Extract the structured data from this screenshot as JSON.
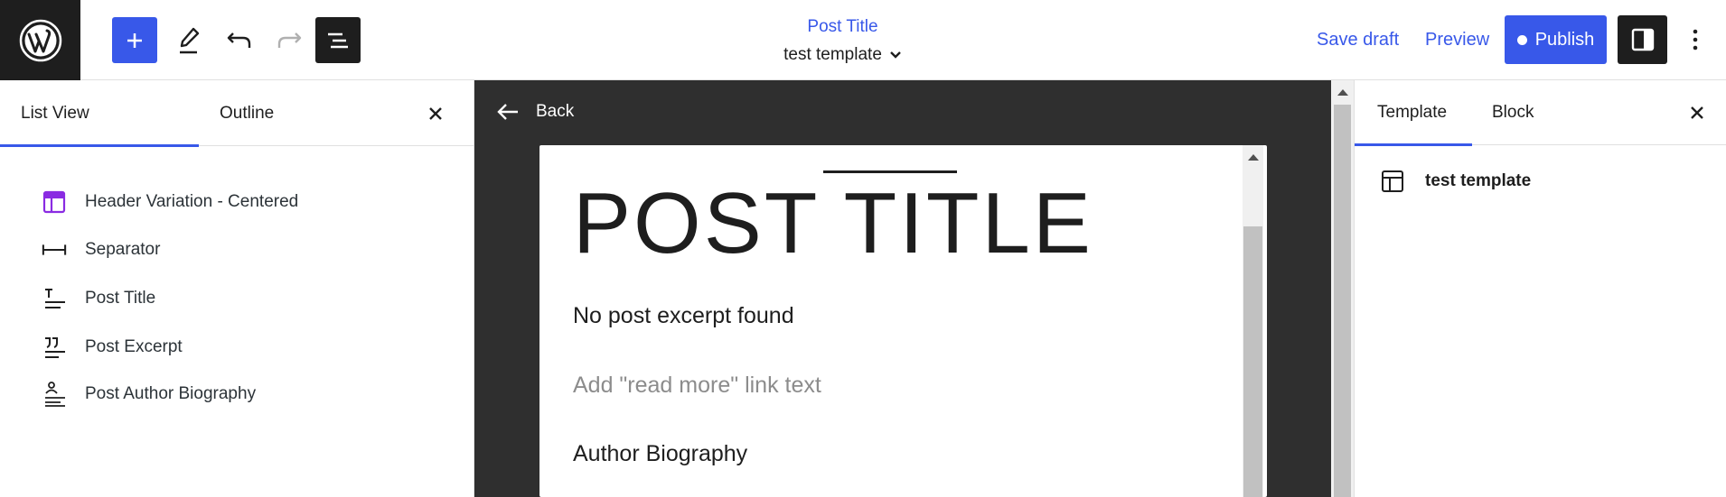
{
  "header": {
    "doc_title": "Post Title",
    "template_name": "test template",
    "save_draft": "Save draft",
    "preview": "Preview",
    "publish": "Publish"
  },
  "left_panel": {
    "tabs": [
      {
        "label": "List View",
        "active": true
      },
      {
        "label": "Outline",
        "active": false
      }
    ],
    "items": [
      {
        "label": "Header Variation - Centered",
        "icon": "template-part-icon"
      },
      {
        "label": "Separator",
        "icon": "separator-icon"
      },
      {
        "label": "Post Title",
        "icon": "post-title-icon"
      },
      {
        "label": "Post Excerpt",
        "icon": "post-excerpt-icon"
      },
      {
        "label": "Post Author Biography",
        "icon": "post-author-biography-icon"
      }
    ]
  },
  "canvas": {
    "back": "Back",
    "post_title": "POST TITLE",
    "excerpt": "No post excerpt found",
    "read_more": "Add \"read more\" link text",
    "author_bio": "Author Biography"
  },
  "right_panel": {
    "tabs": [
      {
        "label": "Template",
        "active": true
      },
      {
        "label": "Block",
        "active": false
      }
    ],
    "template_name": "test template"
  },
  "colors": {
    "accent": "#3858e9",
    "dark": "#1e1e1e",
    "canvas_bg": "#2f2f2f",
    "template_part_icon": "#8a2be2"
  }
}
